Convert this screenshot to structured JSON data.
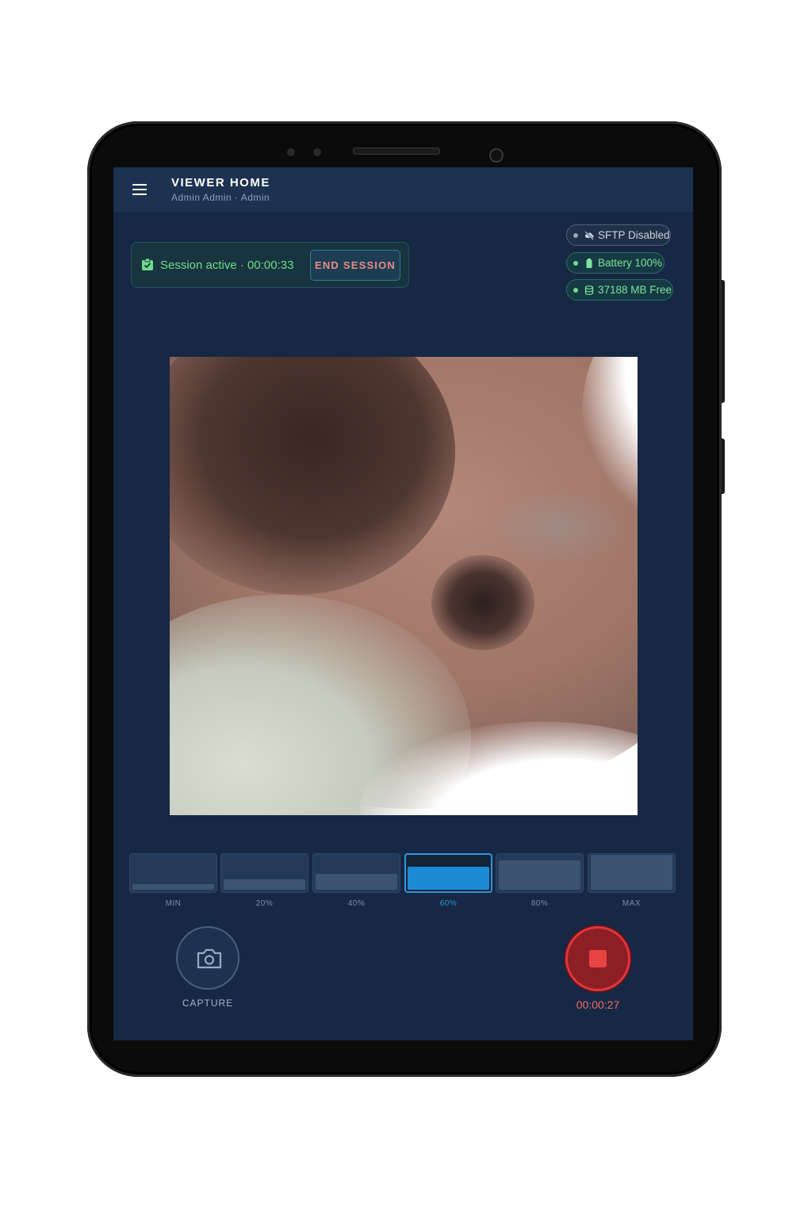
{
  "header": {
    "title": "VIEWER HOME",
    "user_line": "Admin Admin · Admin"
  },
  "session": {
    "status_text": "Session active · 00:00:33",
    "end_button_label": "END SESSION"
  },
  "status_pills": {
    "sftp": "SFTP Disabled",
    "battery": "Battery 100%",
    "storage": "37188 MB Free"
  },
  "brightness": {
    "levels": [
      {
        "label": "MIN",
        "level_percent": 0
      },
      {
        "label": "20%",
        "level_percent": 20
      },
      {
        "label": "40%",
        "level_percent": 40
      },
      {
        "label": "60%",
        "level_percent": 60
      },
      {
        "label": "80%",
        "level_percent": 80
      },
      {
        "label": "MAX",
        "level_percent": 100
      }
    ],
    "selected_index": 3
  },
  "controls": {
    "capture_label": "CAPTURE",
    "record_timer": "00:00:27"
  },
  "colors": {
    "background": "#162844",
    "topbar": "#1d3251",
    "active_green": "#6fdc8c",
    "accent_blue": "#1c8ad4",
    "record_red": "#e84343"
  },
  "icons": {
    "menu": "hamburger-menu-icon",
    "session": "clipboard-check-icon",
    "sftp": "cloud-off-icon",
    "battery": "battery-icon",
    "storage": "database-icon",
    "capture": "camera-icon",
    "record": "stop-icon"
  }
}
